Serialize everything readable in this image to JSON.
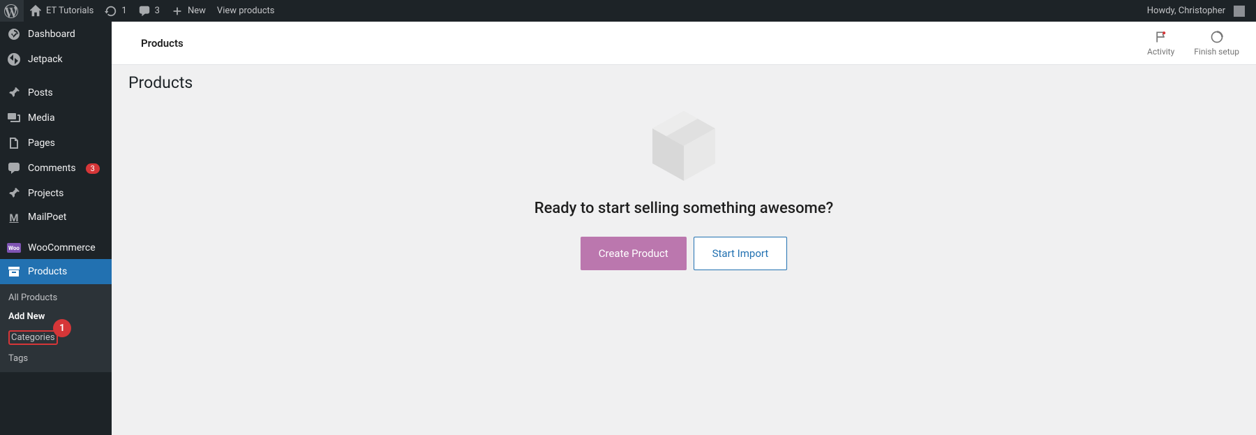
{
  "adminBar": {
    "siteName": "ET Tutorials",
    "updatesCount": "1",
    "commentsCount": "3",
    "newLabel": "New",
    "viewProductsLabel": "View products",
    "greeting": "Howdy, Christopher"
  },
  "sidebar": {
    "dashboard": "Dashboard",
    "jetpack": "Jetpack",
    "posts": "Posts",
    "media": "Media",
    "pages": "Pages",
    "comments": "Comments",
    "commentsBadge": "3",
    "projects": "Projects",
    "mailpoet": "MailPoet",
    "woocommerce": "WooCommerce",
    "products": "Products",
    "submenu": {
      "allProducts": "All Products",
      "addNew": "Add New",
      "categories": "Categories",
      "tags": "Tags"
    }
  },
  "annotation": {
    "marker": "1"
  },
  "header": {
    "breadcrumb": "Products",
    "activityLabel": "Activity",
    "finishSetupLabel": "Finish setup"
  },
  "content": {
    "pageTitle": "Products",
    "emptyHeading": "Ready to start selling something awesome?",
    "createProductLabel": "Create Product",
    "startImportLabel": "Start Import"
  }
}
